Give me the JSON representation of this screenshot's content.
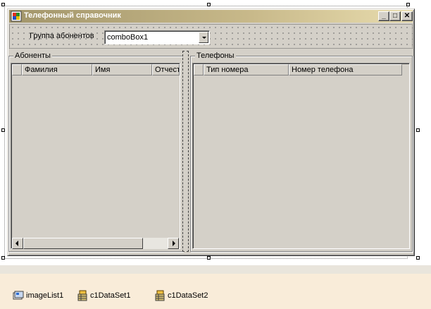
{
  "window": {
    "title": "Телефонный справочник",
    "buttons": {
      "minimize": "_",
      "maximize": "□",
      "close": "✕"
    }
  },
  "top_panel": {
    "group_label": "Группа абонентов",
    "combo_value": "comboBox1"
  },
  "subscribers": {
    "group_title": "Абоненты",
    "columns": [
      "Фамилия",
      "Имя",
      "Отчест"
    ]
  },
  "phones": {
    "group_title": "Телефоны",
    "columns": [
      "Тип номера",
      "Номер телефона"
    ]
  },
  "tray": {
    "items": [
      {
        "label": "imageList1",
        "icon": "image-list-icon"
      },
      {
        "label": "c1DataSet1",
        "icon": "dataset-icon"
      },
      {
        "label": "c1DataSet2",
        "icon": "dataset-icon"
      }
    ]
  },
  "colors": {
    "title_gradient_start": "#a2956a",
    "title_gradient_end": "#e8dcae",
    "surface": "#d4d0c8",
    "tray_background": "#f9ecd9"
  }
}
